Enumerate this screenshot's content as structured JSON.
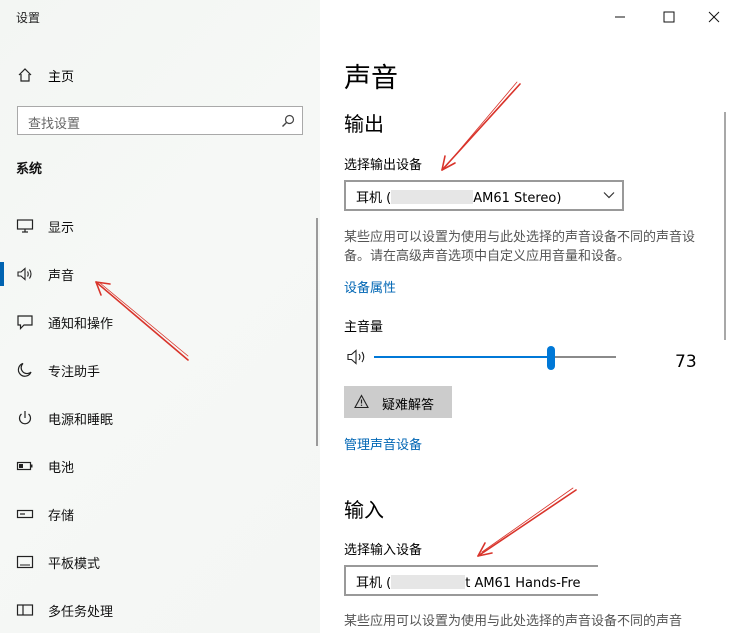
{
  "window": {
    "title": "设置",
    "controls": [
      "minimize-icon",
      "maximize-icon",
      "close-icon"
    ]
  },
  "sidebar": {
    "home_label": "主页",
    "search_placeholder": "查找设置",
    "section_label": "系统",
    "items": [
      {
        "label": "显示",
        "icon": "display-icon",
        "selected": false
      },
      {
        "label": "声音",
        "icon": "speaker-icon",
        "selected": true
      },
      {
        "label": "通知和操作",
        "icon": "notification-icon",
        "selected": false
      },
      {
        "label": "专注助手",
        "icon": "moon-icon",
        "selected": false
      },
      {
        "label": "电源和睡眠",
        "icon": "power-icon",
        "selected": false
      },
      {
        "label": "电池",
        "icon": "battery-icon",
        "selected": false
      },
      {
        "label": "存储",
        "icon": "storage-icon",
        "selected": false
      },
      {
        "label": "平板模式",
        "icon": "tablet-icon",
        "selected": false
      },
      {
        "label": "多任务处理",
        "icon": "multitask-icon",
        "selected": false
      }
    ]
  },
  "main": {
    "title": "声音",
    "output": {
      "heading": "输出",
      "select_label": "选择输出设备",
      "device_prefix": "耳机 (",
      "device_suffix": "AM61 Stereo)",
      "description": "某些应用可以设置为使用与此处选择的声音设备不同的声音设备。请在高级声音选项中自定义应用音量和设备。",
      "device_properties_link": "设备属性",
      "volume_label": "主音量",
      "volume_value": "73",
      "volume_fraction": 0.73,
      "troubleshoot_label": "疑难解答",
      "manage_devices_link": "管理声音设备"
    },
    "input": {
      "heading": "输入",
      "select_label": "选择输入设备",
      "device_prefix": "耳机 (",
      "device_suffix": "t AM61 Hands-Fre",
      "description": "某些应用可以设置为使用与此处选择的声音设备不同的声音"
    }
  },
  "colors": {
    "accent": "#0078d7",
    "link": "#0066b4",
    "annotation_arrow": "#d9342b"
  }
}
